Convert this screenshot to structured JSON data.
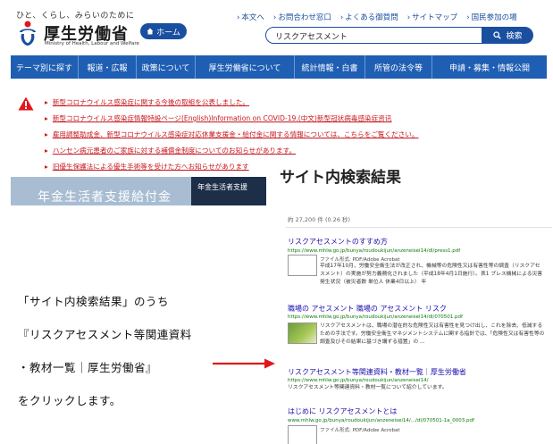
{
  "header": {
    "tagline": "ひと、くらし、みらいのために",
    "logo_name": "厚生労働省",
    "logo_sub": "Ministry of Health, Labour and Welfare",
    "home_label": "ホーム",
    "top_links": [
      "本文へ",
      "お問合わせ窓口",
      "よくある御質問",
      "サイトマップ",
      "国民参加の場"
    ],
    "search_value": "リスクアセスメント",
    "search_button": "検索"
  },
  "nav": {
    "items": [
      "テーマ別に探す",
      "報道・広報",
      "政策について",
      "厚生労働省について",
      "統計情報・白書",
      "所管の法令等",
      "申請・募集・情報公開"
    ]
  },
  "notices": [
    "新型コロナウイルス感染症に関する今後の取組を公表しました。",
    "新型コロナウイルス感染症情報特設ページ(English)Information on COVID-19.(中文)新型冠状病毒感染症资讯",
    "雇用調整助成金、新型コロナウイルス感染症対応休業支援金・給付金に関する情報については、こちらをご覧ください。",
    "ハンセン病元患者のご家族に対する補償金制度についてのお知らせがあります。",
    "旧優生保護法による優生手術等を受けた方へお知らせがあります"
  ],
  "banner": {
    "text": "年金生活者支援給付金",
    "side_text": "年金生活者支援"
  },
  "results": {
    "title": "サイト内検索結果",
    "count": "約 27,200 件 (0.26 秒)",
    "items": [
      {
        "title": "リスクアセスメントのすすめ方",
        "url": "https://www.mhlw.go.jp/bunya/roudoukijun/anzeneisei14/dl/press1.pdf",
        "filetype": "ファイル形式: PDF/Adobe Acrobat",
        "snippet": "平成17年10月、労働安全衛生法が改正され、機械等の危険性又は有害性等の調査（リスクアセスメント）の実施が努力義務化されました（平成18年4月1日施行）。表1 プレス機械による災害発生状況（被災者数 単位人 休業4日以上） 年"
      },
      {
        "title": "職場の アセスメント 職場の アセスメント リスク",
        "url": "https://www.mhlw.go.jp/bunya/roudoukijun/anzeneisei14/dl/070501.pdf",
        "filetype": "",
        "snippet": "リスクアセスメントは、職場の潜在的な危険性又は有害性を見つけ出し、これを除去、低減するための手法です。労働安全衛生マネジメントシステムに関する指針では、「危険性又は有害性等の調査及びその結果に基づき講ずる措置」の ..."
      },
      {
        "title": "リスクアセスメント等関連資料・教材一覧｜厚生労働省",
        "url": "https://www.mhlw.go.jp/bunya/roudoukijun/anzeneisei14/",
        "filetype": "",
        "snippet": "リスクアセスメント等関連資料・教材一覧について紹介しています。"
      },
      {
        "title": "はじめに リスクアセスメントとは",
        "url": "www.mhlw.go.jp/bunya/roudoukijun/anzeneisei14/.../dl/070501-1a_0003.pdf",
        "filetype": "ファイル形式: PDF/Adobe Acrobat",
        "snippet": ""
      }
    ]
  },
  "annotation": {
    "lines": [
      "「サイト内検索結果」のうち",
      "『リスクアセスメント等関連資料",
      "・教材一覧｜厚生労働省』",
      "をクリックします。"
    ]
  },
  "colors": {
    "brand_blue": "#1f5fb3",
    "notice_red": "#c8161d",
    "link_blue": "#1a0dab",
    "url_green": "#0b7a0b",
    "arrow_red": "#e0171d"
  }
}
